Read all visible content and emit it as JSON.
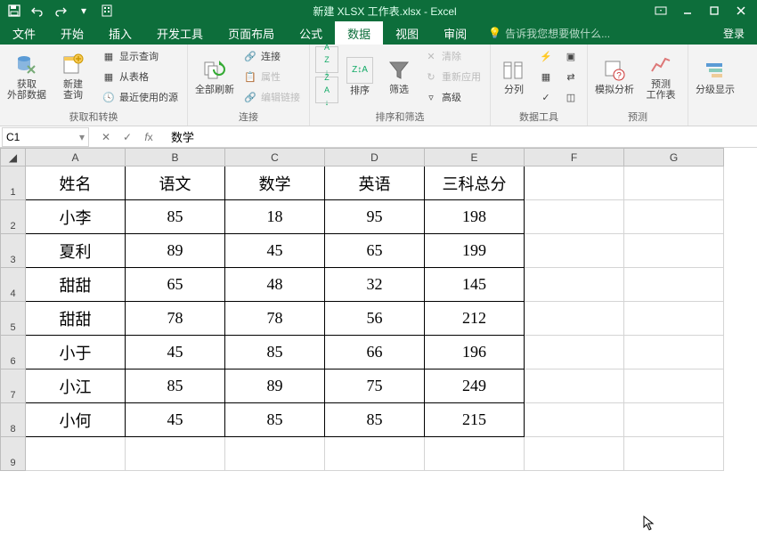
{
  "title": "新建 XLSX 工作表.xlsx - Excel",
  "tabs": [
    "文件",
    "开始",
    "插入",
    "开发工具",
    "页面布局",
    "公式",
    "数据",
    "视图",
    "审阅"
  ],
  "active_tab": 6,
  "tell_me": "告诉我您想要做什么...",
  "login": "登录",
  "ribbon": {
    "g1": {
      "label": "获取和转换",
      "btn1": "获取\n外部数据",
      "btn2": "新建\n查询",
      "s1": "显示查询",
      "s2": "从表格",
      "s3": "最近使用的源"
    },
    "g2": {
      "label": "连接",
      "btn": "全部刷新",
      "s1": "连接",
      "s2": "属性",
      "s3": "编辑链接"
    },
    "g3": {
      "label": "排序和筛选",
      "btn1": "排序",
      "btn2": "筛选",
      "s1": "清除",
      "s2": "重新应用",
      "s3": "高级"
    },
    "g4": {
      "label": "数据工具",
      "btn": "分列"
    },
    "g5": {
      "label": "预测",
      "btn1": "模拟分析",
      "btn2": "预测\n工作表"
    },
    "g6": {
      "label": "",
      "btn": "分级显示"
    }
  },
  "az_up": "A",
  "az_dn": "Z",
  "name_box": "C1",
  "formula": "数学",
  "cols": [
    "A",
    "B",
    "C",
    "D",
    "E",
    "F",
    "G"
  ],
  "rows": [
    "1",
    "2",
    "3",
    "4",
    "5",
    "6",
    "7",
    "8",
    "9"
  ],
  "headers": [
    "姓名",
    "语文",
    "数学",
    "英语",
    "三科总分"
  ],
  "data": [
    [
      "小李",
      "85",
      "18",
      "95",
      "198"
    ],
    [
      "夏利",
      "89",
      "45",
      "65",
      "199"
    ],
    [
      "甜甜",
      "65",
      "48",
      "32",
      "145"
    ],
    [
      "甜甜",
      "78",
      "78",
      "56",
      "212"
    ],
    [
      "小于",
      "45",
      "85",
      "66",
      "196"
    ],
    [
      "小江",
      "85",
      "89",
      "75",
      "249"
    ],
    [
      "小何",
      "45",
      "85",
      "85",
      "215"
    ]
  ]
}
